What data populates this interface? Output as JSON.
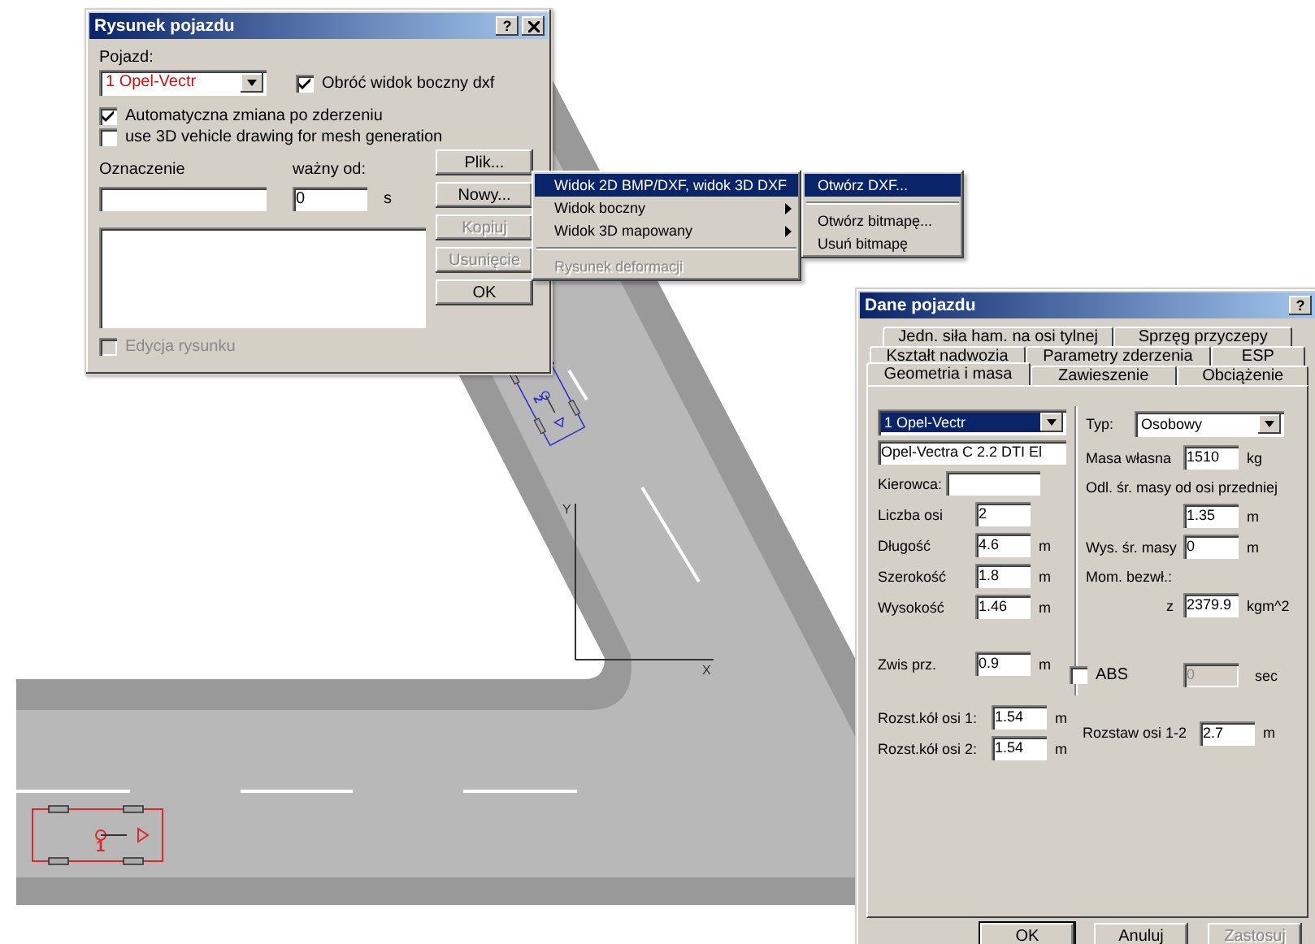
{
  "scene": {
    "axis_labels": [
      "Y",
      "X"
    ],
    "vehicles": [
      {
        "label": "1",
        "color": "#e02828"
      },
      {
        "label": "2",
        "color": "#2a2ad0"
      }
    ]
  },
  "drawing_dialog": {
    "title": "Rysunek pojazdu",
    "help": "?",
    "vehicle_label": "Pojazd:",
    "vehicle_select": "1  Opel-Vectr",
    "checkboxes": [
      {
        "label": "Obróć widok boczny dxf",
        "checked": true
      },
      {
        "label": "Automatyczna zmiana po zderzeniu",
        "checked": true
      },
      {
        "label": "use 3D vehicle drawing for mesh generation",
        "checked": false
      }
    ],
    "designation_label": "Oznaczenie",
    "valid_from_label": "ważny od:",
    "valid_from_value": "0",
    "valid_from_unit": "s",
    "buttons": [
      {
        "label": "Plik...",
        "disabled": false
      },
      {
        "label": "Nowy...",
        "disabled": false
      },
      {
        "label": "Kopiuj",
        "disabled": true
      },
      {
        "label": "Usunięcie",
        "disabled": true
      },
      {
        "label": "OK",
        "disabled": false
      }
    ],
    "edit_checkbox": {
      "label": "Edycja rysunku",
      "checked": false,
      "disabled": true
    }
  },
  "file_menu": {
    "items": [
      {
        "label": "Widok 2D BMP/DXF, widok 3D DXF",
        "submenu": true,
        "selected": true,
        "disabled": false
      },
      {
        "label": "Widok boczny",
        "submenu": true,
        "selected": false,
        "disabled": false
      },
      {
        "label": "Widok 3D mapowany",
        "submenu": true,
        "selected": false,
        "disabled": false
      },
      {
        "label": "Rysunek deformacji",
        "submenu": false,
        "selected": false,
        "disabled": true
      }
    ]
  },
  "submenu": {
    "items": [
      {
        "label": "Otwórz DXF...",
        "selected": true
      },
      {
        "label": "Otwórz bitmapę...",
        "selected": false
      },
      {
        "label": "Usuń bitmapę",
        "selected": false
      }
    ]
  },
  "vehicle_dialog": {
    "title": "Dane pojazdu",
    "help": "?",
    "tab_rows": [
      [
        {
          "label": "Jedn. siła ham. na osi tylnej",
          "selected": false
        },
        {
          "label": "Sprzęg przyczepy",
          "selected": false
        }
      ],
      [
        {
          "label": "Kształt nadwozia",
          "selected": false
        },
        {
          "label": "Parametry zderzenia",
          "selected": false
        },
        {
          "label": "ESP",
          "selected": false
        }
      ],
      [
        {
          "label": "Geometria i masa",
          "selected": true
        },
        {
          "label": "Zawieszenie",
          "selected": false
        },
        {
          "label": "Obciążenie",
          "selected": false
        }
      ]
    ],
    "vehicle_select": {
      "value": "1  Opel-Vectr",
      "highlighted": true
    },
    "model_name": "Opel-Vectra C  2.2 DTI El",
    "driver_label": "Kierowca:",
    "left_fields": [
      {
        "label": "Liczba osi",
        "value": "2"
      },
      {
        "label": "Długość",
        "value": "4.6",
        "unit": "m"
      },
      {
        "label": "Szerokość",
        "value": "1.8",
        "unit": "m"
      },
      {
        "label": "Wysokość",
        "value": "1.46",
        "unit": "m"
      },
      {
        "label": "Zwis prz.",
        "value": "0.9",
        "unit": "m"
      }
    ],
    "type_label": "Typ:",
    "type_value": "Osobowy",
    "mass_label": "Masa własna",
    "mass_value": "1510",
    "mass_unit": "kg",
    "cog_distance_label": "Odl. śr. masy od osi przedniej",
    "cog_distance_value": "1.35",
    "cog_distance_unit": "m",
    "cog_height_label": "Wys. śr. masy",
    "cog_height_value": "0",
    "cog_height_unit": "m",
    "inertia_label": "Mom. bezwł.:",
    "inertia_axis": "z",
    "inertia_value": "2379.9",
    "inertia_unit": "kgm^2",
    "abs": {
      "label": "ABS",
      "checked": false,
      "value": "0",
      "unit": "sec"
    },
    "track_fields": [
      {
        "label": "Rozst.kół osi 1:",
        "value": "1.54",
        "unit": "m"
      },
      {
        "label": "Rozst.kół osi 2:",
        "value": "1.54",
        "unit": "m"
      }
    ],
    "wheelbase": {
      "label": "Rozstaw osi 1-2",
      "value": "2.7",
      "unit": "m"
    },
    "buttons": [
      {
        "label": "OK",
        "disabled": false
      },
      {
        "label": "Anuluj",
        "disabled": false
      },
      {
        "label": "Zastosuj",
        "disabled": true
      }
    ]
  }
}
